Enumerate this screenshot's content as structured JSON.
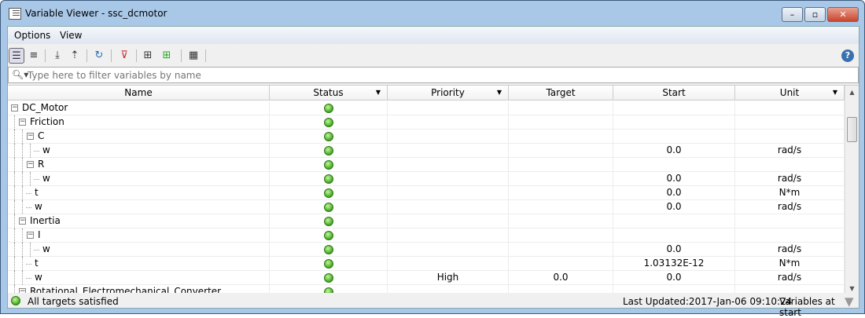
{
  "window": {
    "title": "Variable Viewer - ssc_dcmotor",
    "minimize": "–",
    "maximize": "▫",
    "close": "✕"
  },
  "menu": [
    "Options",
    "View"
  ],
  "toolbar": {
    "help": "?"
  },
  "filter": {
    "placeholder": "Type here to filter variables by name",
    "value": ""
  },
  "columns": [
    "Name",
    "Status",
    "Priority",
    "Target",
    "Start",
    "Unit"
  ],
  "rows": [
    {
      "name": "DC_Motor",
      "level": 0,
      "expander": true,
      "priority": "",
      "target": "",
      "start": "",
      "unit": ""
    },
    {
      "name": "Friction",
      "level": 1,
      "expander": true,
      "priority": "",
      "target": "",
      "start": "",
      "unit": ""
    },
    {
      "name": "C",
      "level": 2,
      "expander": true,
      "priority": "",
      "target": "",
      "start": "",
      "unit": ""
    },
    {
      "name": "w",
      "level": 3,
      "expander": false,
      "priority": "",
      "target": "",
      "start": "0.0",
      "unit": "rad/s"
    },
    {
      "name": "R",
      "level": 2,
      "expander": true,
      "priority": "",
      "target": "",
      "start": "",
      "unit": ""
    },
    {
      "name": "w",
      "level": 3,
      "expander": false,
      "priority": "",
      "target": "",
      "start": "0.0",
      "unit": "rad/s"
    },
    {
      "name": "t",
      "level": 2,
      "expander": false,
      "priority": "",
      "target": "",
      "start": "0.0",
      "unit": "N*m"
    },
    {
      "name": "w",
      "level": 2,
      "expander": false,
      "priority": "",
      "target": "",
      "start": "0.0",
      "unit": "rad/s"
    },
    {
      "name": "Inertia",
      "level": 1,
      "expander": true,
      "priority": "",
      "target": "",
      "start": "",
      "unit": ""
    },
    {
      "name": "I",
      "level": 2,
      "expander": true,
      "priority": "",
      "target": "",
      "start": "",
      "unit": ""
    },
    {
      "name": "w",
      "level": 3,
      "expander": false,
      "priority": "",
      "target": "",
      "start": "0.0",
      "unit": "rad/s"
    },
    {
      "name": "t",
      "level": 2,
      "expander": false,
      "priority": "",
      "target": "",
      "start": "1.03132E-12",
      "unit": "N*m"
    },
    {
      "name": "w",
      "level": 2,
      "expander": false,
      "priority": "High",
      "target": "0.0",
      "start": "0.0",
      "unit": "rad/s"
    },
    {
      "name": "Rotational_Electromechanical_Converter",
      "level": 1,
      "expander": true,
      "priority": "",
      "target": "",
      "start": "",
      "unit": ""
    }
  ],
  "status": {
    "message": "All targets satisfied",
    "last_updated": "Last Updated:2017-Jan-06 09:10:24",
    "mode": "Variables at start"
  }
}
